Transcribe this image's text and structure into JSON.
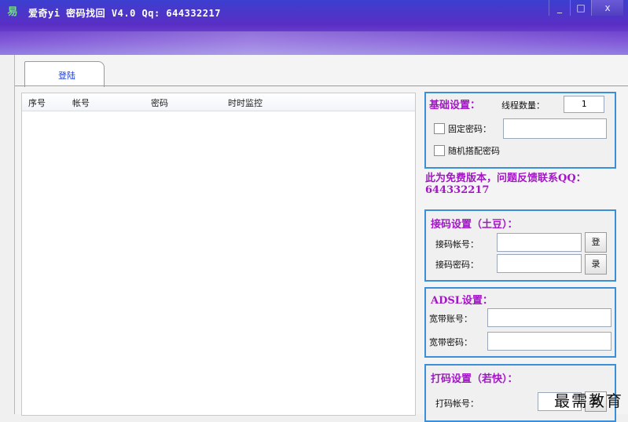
{
  "window": {
    "title": "爱奇yi 密码找回 V4.0  Qq: 644332217",
    "app_icon": "易",
    "controls": {
      "minimize": "_",
      "maximize": "□",
      "close": "x"
    }
  },
  "tabs": [
    {
      "label": "登陆"
    }
  ],
  "list": {
    "columns": [
      "序号",
      "帐号",
      "密码",
      "时时监控"
    ],
    "rows": []
  },
  "basic_settings": {
    "title": "基础设置：",
    "thread_label": "线程数量：",
    "thread_value": "1",
    "fixed_password_label": "固定密码：",
    "fixed_password_value": "",
    "random_password_label": "随机搭配密码"
  },
  "notice": "此为免费版本，问题反馈联系QQ：644332217",
  "receiver_settings": {
    "title": "接码设置（土豆）：",
    "account_label": "接码帐号：",
    "password_label": "接码密码：",
    "login_button_top": "登",
    "login_button_bottom": "录"
  },
  "adsl_settings": {
    "title": "ADSL设置：",
    "account_label": "宽带账号：",
    "password_label": "宽带密码："
  },
  "captcha_settings": {
    "title": "打码设置（若快）：",
    "account_label": "打码帐号：",
    "login_button_top": "登"
  },
  "watermark": "最需教育",
  "colors": {
    "accent": "#a217c4",
    "group_border": "#3b8fd8",
    "tab_text": "#1a3ad0"
  }
}
